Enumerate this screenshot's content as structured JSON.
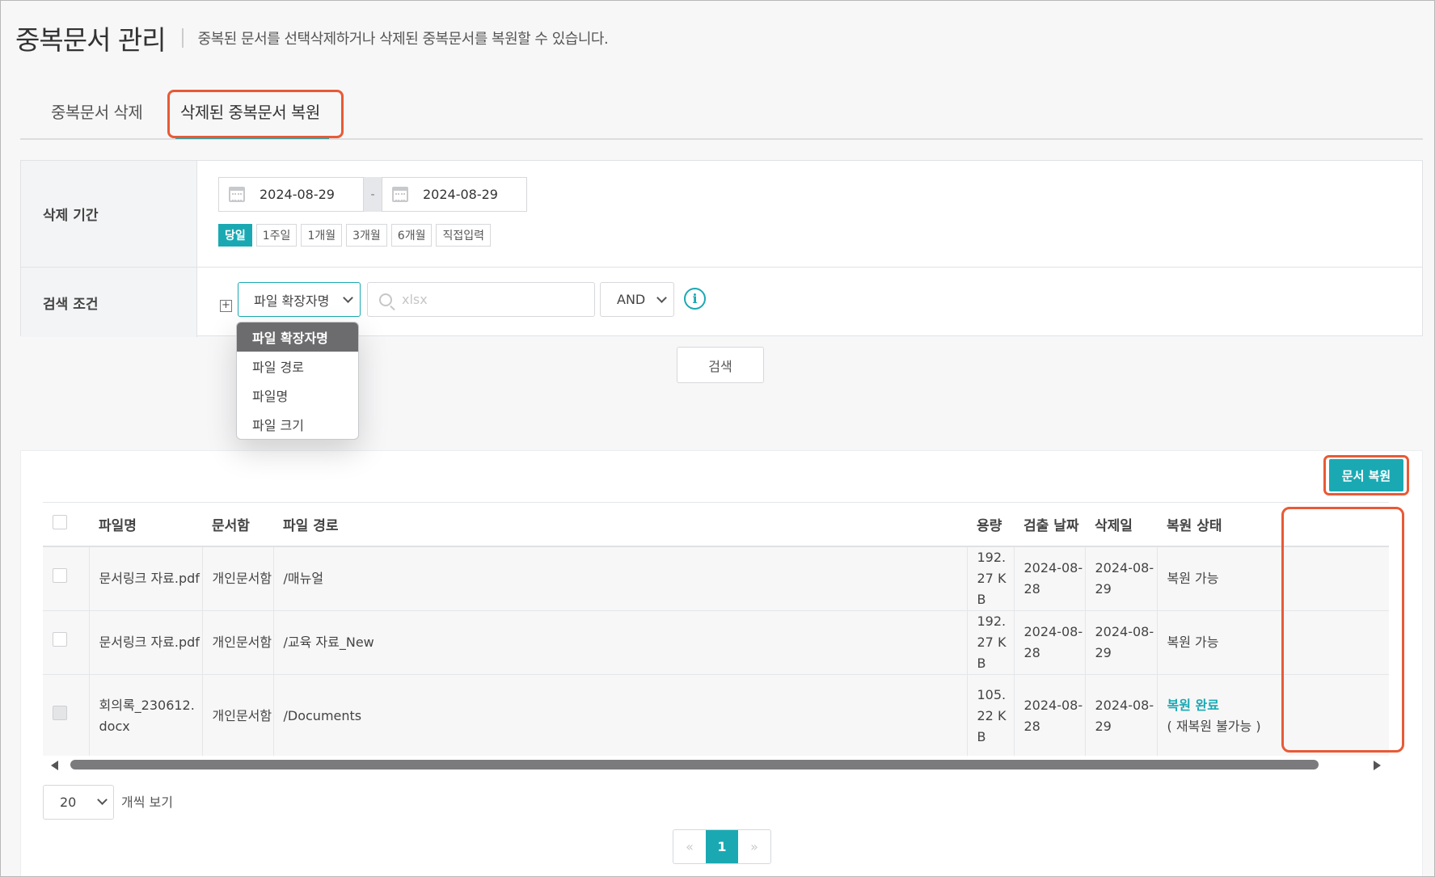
{
  "header": {
    "title": "중복문서 관리",
    "description": "중복된 문서를 선택삭제하거나 삭제된 중복문서를 복원할 수 있습니다."
  },
  "tabs": [
    {
      "label": "중복문서 삭제",
      "active": false
    },
    {
      "label": "삭제된 중복문서 복원",
      "active": true
    }
  ],
  "filter": {
    "period_label": "삭제 기간",
    "date_from": "2024-08-29",
    "date_separator": "-",
    "date_to": "2024-08-29",
    "quick_ranges": [
      "당일",
      "1주일",
      "1개월",
      "3개월",
      "6개월",
      "직접입력"
    ],
    "active_quick_range": "당일",
    "condition_label": "검색 조건",
    "add_condition_symbol": "+",
    "field_select": "파일 확장자명",
    "search_placeholder": "xlsx",
    "operator_select": "AND",
    "info_symbol": "i",
    "search_button": "검색"
  },
  "dropdown": {
    "options": [
      "파일 확장자명",
      "파일 경로",
      "파일명",
      "파일 크기"
    ],
    "selected": "파일 확장자명"
  },
  "results": {
    "restore_button": "문서 복원",
    "columns": [
      "파일명",
      "문서함",
      "파일 경로",
      "용량",
      "검출 날짜",
      "삭제일",
      "복원 상태"
    ],
    "rows": [
      {
        "filename": "문서링크 자료.pdf",
        "box": "개인문서함",
        "path": "/매뉴얼",
        "size": "192.27 KB",
        "detected": "2024-08-28",
        "deleted": "2024-08-29",
        "status": "복원 가능",
        "status_note": "",
        "checkbox_enabled": true
      },
      {
        "filename": "문서링크 자료.pdf",
        "box": "개인문서함",
        "path": "/교육 자료_New",
        "size": "192.27 KB",
        "detected": "2024-08-28",
        "deleted": "2024-08-29",
        "status": "복원 가능",
        "status_note": "",
        "checkbox_enabled": true
      },
      {
        "filename": "회의록_230612.docx",
        "box": "개인문서함",
        "path": "/Documents",
        "size": "105.22 KB",
        "detected": "2024-08-28",
        "deleted": "2024-08-29",
        "status": "복원 완료",
        "status_note": "( 재복원 불가능 )",
        "checkbox_enabled": false
      }
    ]
  },
  "footer": {
    "page_size": "20",
    "page_size_label": "개씩 보기",
    "prev_symbol": "«",
    "current_page": "1",
    "next_symbol": "»"
  },
  "colors": {
    "accent": "#1aa9b3",
    "highlight": "#e85a36"
  }
}
